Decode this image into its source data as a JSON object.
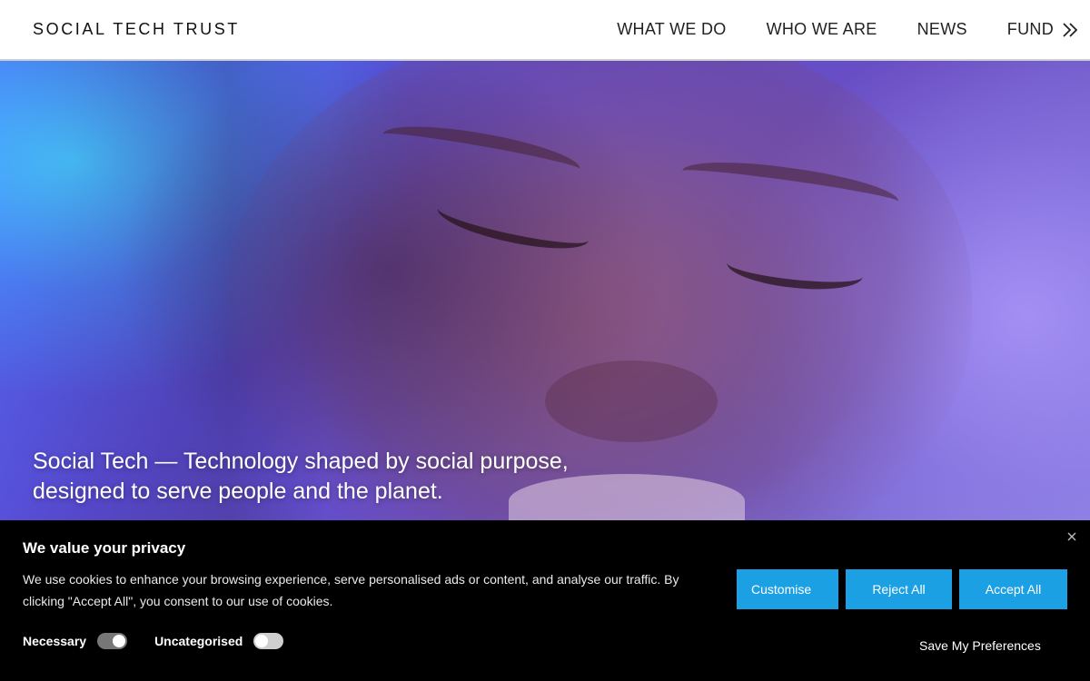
{
  "header": {
    "logo": "SOCIAL TECH TRUST",
    "nav": [
      {
        "label": "WHAT WE DO"
      },
      {
        "label": "WHO WE ARE"
      },
      {
        "label": "NEWS"
      },
      {
        "label": "FUND"
      }
    ],
    "fund_icon": "double-chevron-right-icon"
  },
  "hero": {
    "line1": "Social Tech — Technology shaped by social purpose,",
    "line2": "designed to serve people and the planet."
  },
  "cookie_banner": {
    "title": "We value your privacy",
    "text": "We use cookies to enhance your browsing experience, serve personalised ads or content, and analyse our traffic. By clicking \"Accept All\", you consent to our use of cookies.",
    "toggles": [
      {
        "label": "Necessary",
        "state": "on"
      },
      {
        "label": "Uncategorised",
        "state": "off"
      }
    ],
    "buttons": {
      "customise": "Customise",
      "reject": "Reject All",
      "accept": "Accept All",
      "save": "Save My Preferences"
    },
    "close_icon": "close-icon",
    "accent_color": "#1ba0e4"
  }
}
